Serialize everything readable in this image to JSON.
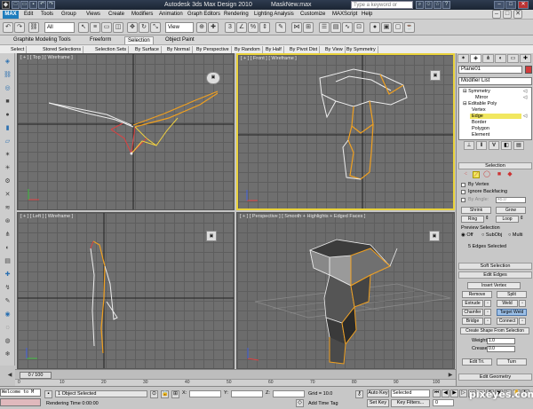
{
  "titlebar": {
    "app_title": "Autodesk 3ds Max Design 2010",
    "file_name": "MaskNew.max",
    "search_placeholder": "Type a keyword or phrase"
  },
  "menu": [
    "Edit",
    "Tools",
    "Group",
    "Views",
    "Create",
    "Modifiers",
    "Animation",
    "Graph Editors",
    "Rendering",
    "Lighting Analysis",
    "Customize",
    "MAXScript",
    "Help"
  ],
  "toolbar": {
    "selection_filter": "All",
    "reference_coord": "View"
  },
  "ribbon": {
    "tabs": [
      "Graphite Modeling Tools",
      "Freeform",
      "Selection",
      "Object Paint"
    ],
    "active_tab_index": 2,
    "sub_buttons": [
      "Select",
      "Stored Selections",
      "Selection Sets",
      "By Surface",
      "By Normal",
      "By Perspective",
      "By Random",
      "By Half",
      "By Pivot Dist",
      "By View",
      "By Symmetry"
    ]
  },
  "viewports": {
    "top": "[ + ] [ Top ] [ Wireframe ]",
    "front": "[ + ] [ Front ] [ Wireframe ]",
    "left": "[ + ] [ Left ] [ Wireframe ]",
    "perspective": "[ + ] [ Perspective ] [ Smooth + Highlights + Edged Faces ]"
  },
  "panel": {
    "object_name": "Plane01",
    "modifier_list": "Modifier List",
    "stack": [
      {
        "label": "Symmetry",
        "indent": 0,
        "highlight": false
      },
      {
        "label": "Mirror",
        "indent": 2,
        "highlight": false
      },
      {
        "label": "Editable Poly",
        "indent": 0,
        "highlight": false
      },
      {
        "label": "Vertex",
        "indent": 1,
        "highlight": false
      },
      {
        "label": "Edge",
        "indent": 1,
        "highlight": true
      },
      {
        "label": "Border",
        "indent": 1,
        "highlight": false
      },
      {
        "label": "Polygon",
        "indent": 1,
        "highlight": false
      },
      {
        "label": "Element",
        "indent": 1,
        "highlight": false
      }
    ],
    "selection": {
      "header": "Selection",
      "by_vertex": "By Vertex",
      "ignore_backfacing": "Ignore Backfacing",
      "by_angle": "By Angle:",
      "by_angle_value": "45.0",
      "shrink": "Shrink",
      "grow": "Grow",
      "ring": "Ring",
      "loop": "Loop",
      "preview_selection": "Preview Selection",
      "preview_options": [
        "Off",
        "SubObj",
        "Multi"
      ],
      "status": "5 Edges Selected"
    },
    "soft_selection": "Soft Selection",
    "edit_edges": {
      "header": "Edit Edges",
      "insert_vertex": "Insert Vertex",
      "remove": "Remove",
      "split": "Split",
      "extrude": "Extrude",
      "weld": "Weld",
      "chamfer": "Chamfer",
      "target_weld": "Target Weld",
      "bridge": "Bridge",
      "connect": "Connect",
      "create_shape": "Create Shape From Selection",
      "weight_label": "Weight:",
      "weight_value": "1.0",
      "crease_label": "Crease:",
      "crease_value": "0.0",
      "edit_tri": "Edit Tri.",
      "turn": "Turn"
    },
    "edit_geometry": "Edit Geometry"
  },
  "timeline": {
    "frame": "0 / 100",
    "ticks": [
      "0",
      "10",
      "20",
      "30",
      "40",
      "50",
      "60",
      "70",
      "80",
      "90",
      "100"
    ]
  },
  "status": {
    "maxscript": "Welcome to M",
    "objects": "1 Object Selected",
    "render_time": "Rendering Time  0:00:00",
    "x_label": "X:",
    "y_label": "Y:",
    "z_label": "Z:",
    "grid": "Grid = 10.0",
    "add_time_tag": "Add Time Tag",
    "auto_key": "Auto Key",
    "set_key": "Set Key",
    "selected": "Selected",
    "key_filters": "Key Filters...",
    "frame_field": "0"
  },
  "watermark": "pixeyes.com"
}
